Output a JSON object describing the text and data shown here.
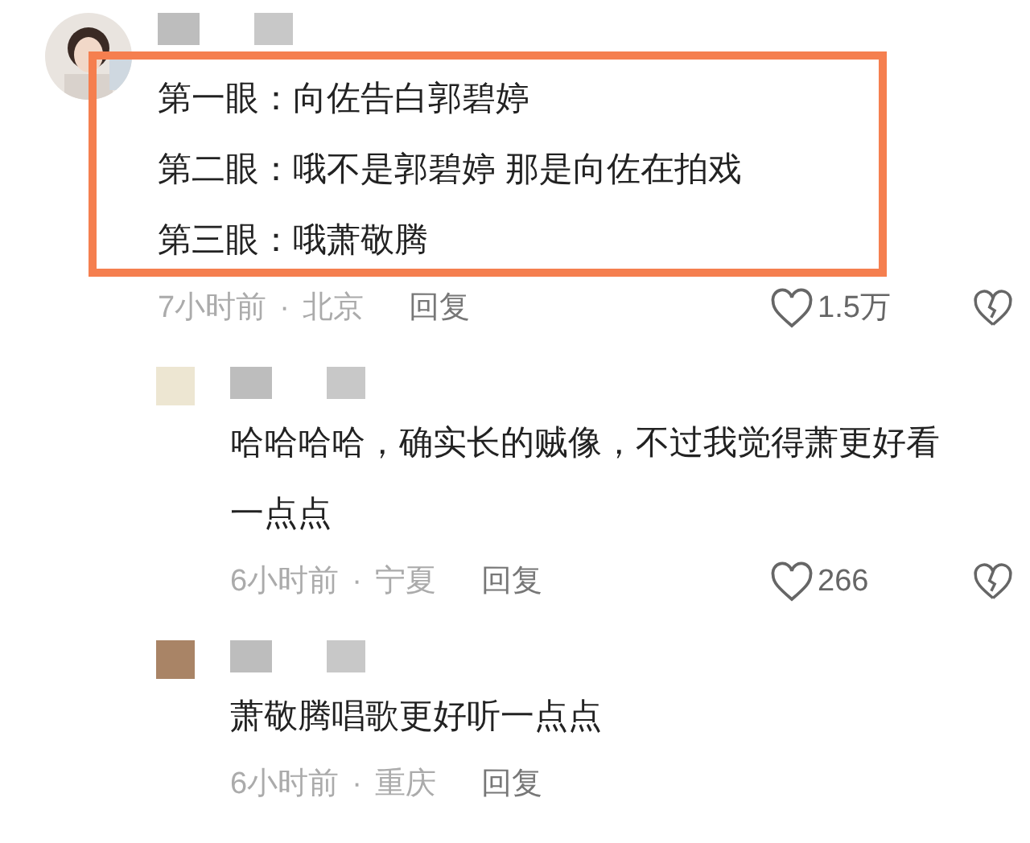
{
  "comments": [
    {
      "kind": "top",
      "lines": [
        "第一眼：向佐告白郭碧婷",
        "第二眼：哦不是郭碧婷 那是向佐在拍戏",
        "第三眼：哦萧敬腾"
      ],
      "highlighted": true,
      "time": "7小时前",
      "separator": "·",
      "location": "北京",
      "reply": "回复",
      "likes": "1.5万"
    },
    {
      "kind": "reply",
      "color": "#ede6d2",
      "lines": [
        "哈哈哈哈，确实长的贼像，不过我觉得萧更好看一点点"
      ],
      "highlighted": false,
      "time": "6小时前",
      "separator": "·",
      "location": "宁夏",
      "reply": "回复",
      "likes": "266"
    },
    {
      "kind": "reply",
      "color": "#a98466",
      "lines": [
        "萧敬腾唱歌更好听一点点"
      ],
      "highlighted": false,
      "time": "6小时前",
      "separator": "·",
      "location": "重庆",
      "reply": "回复"
    }
  ]
}
